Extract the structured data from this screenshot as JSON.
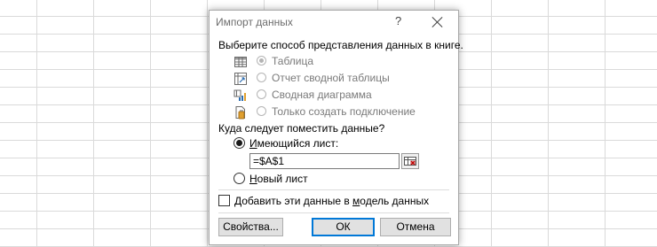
{
  "dialog": {
    "title": "Импорт данных",
    "help_label": "?",
    "section_view_label": "Выберите способ представления данных в книге.",
    "view_options": [
      {
        "label": "Таблица",
        "icon": "table-icon",
        "selected": true
      },
      {
        "label": "Отчет сводной таблицы",
        "icon": "pivot-table-icon",
        "selected": false
      },
      {
        "label": "Сводная диаграмма",
        "icon": "pivot-chart-icon",
        "selected": false
      },
      {
        "label": "Только создать подключение",
        "icon": "connection-icon",
        "selected": false
      }
    ],
    "section_location_label": "Куда следует поместить данные?",
    "existing_sheet": {
      "accel": "И",
      "rest": "меющийся лист:",
      "selected": true
    },
    "range_value": "=$A$1",
    "new_sheet": {
      "accel": "Н",
      "rest": "овый лист",
      "selected": false
    },
    "data_model": {
      "before": "Добавить эти данные в ",
      "accel": "м",
      "after": "одель данных",
      "checked": false
    },
    "buttons": {
      "properties": "Свойства...",
      "ok": "ОК",
      "cancel": "Отмена"
    },
    "accent_color": "#0078d7"
  }
}
